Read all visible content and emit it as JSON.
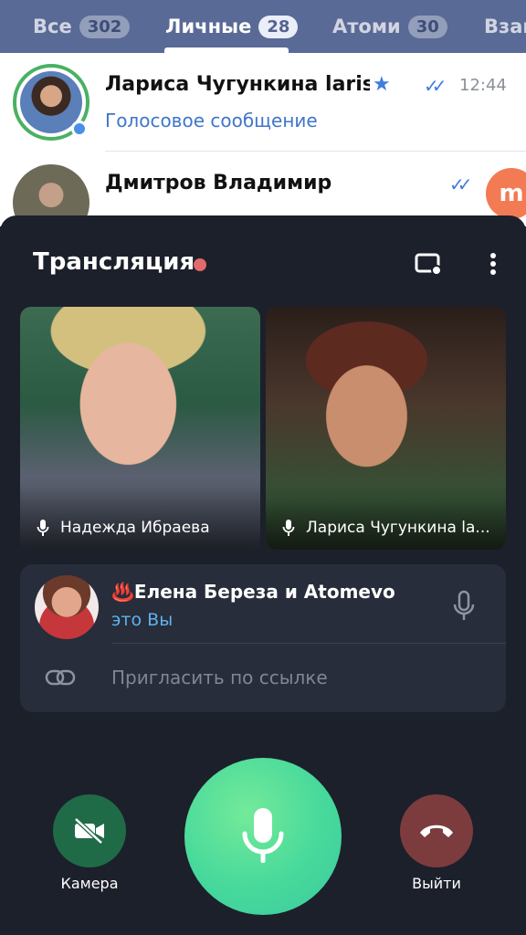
{
  "tabs": [
    {
      "label": "Все",
      "count": "302"
    },
    {
      "label": "Личные",
      "count": "28"
    },
    {
      "label": "Атоми",
      "count": "30"
    },
    {
      "label": "Взаи",
      "count": ""
    }
  ],
  "chats": [
    {
      "name": "Лариса Чугункина larisa",
      "time": "12:44",
      "preview": "Голосовое сообщение"
    },
    {
      "name": "Дмитров Владимир",
      "time": "",
      "preview": ""
    }
  ],
  "voice_chat": {
    "title": "Трансляция",
    "videos": [
      {
        "name": "Надежда Ибраева"
      },
      {
        "name": "Лариса Чугункина la..."
      }
    ],
    "me": {
      "name": "♨️Елена Береза и Atomevo",
      "status": "это Вы"
    },
    "invite_label": "Пригласить по ссылке",
    "camera_label": "Камера",
    "leave_label": "Выйти"
  },
  "colors": {
    "tabbar": "#5a6a96",
    "sheet_bg": "#1c202b",
    "card_bg": "#272d3a",
    "mic_green": "#47d99b",
    "camera_green": "#1f6b48",
    "leave_red": "#7c3c3e",
    "accent_blue": "#5fb2ef"
  }
}
